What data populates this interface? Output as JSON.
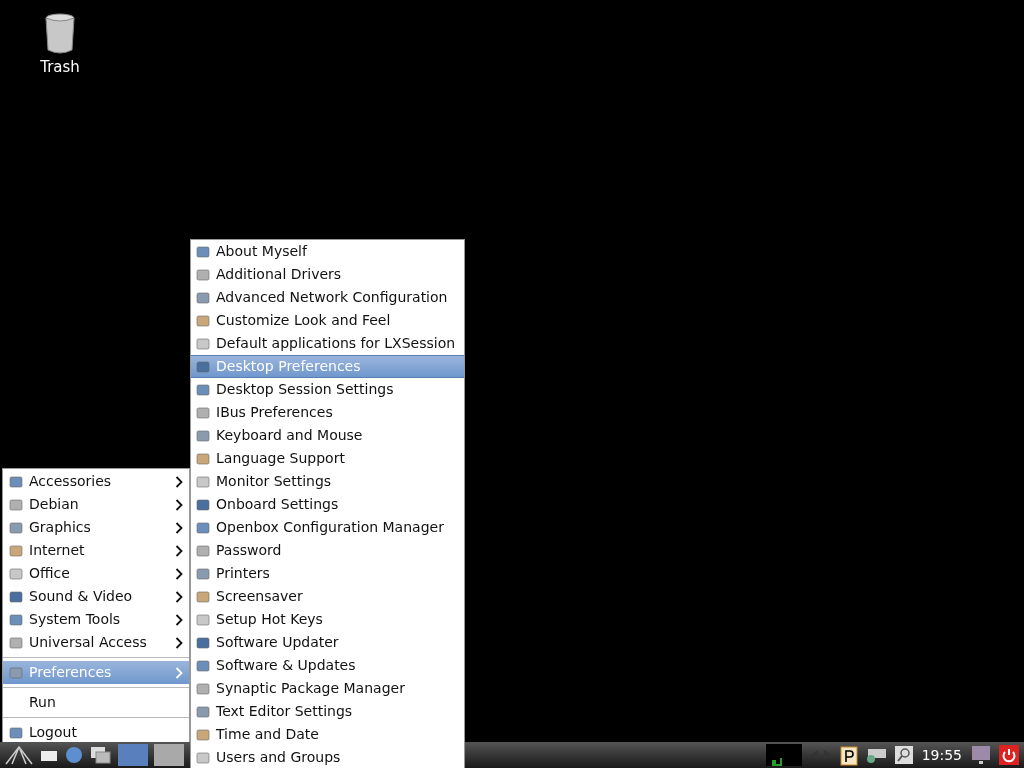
{
  "desktop": {
    "icons": [
      {
        "label": "Trash"
      }
    ]
  },
  "main_menu": {
    "sections": [
      [
        {
          "label": "Accessories",
          "selected": false,
          "has_submenu": true
        },
        {
          "label": "Debian",
          "selected": false,
          "has_submenu": true
        },
        {
          "label": "Graphics",
          "selected": false,
          "has_submenu": true
        },
        {
          "label": "Internet",
          "selected": false,
          "has_submenu": true
        },
        {
          "label": "Office",
          "selected": false,
          "has_submenu": true
        },
        {
          "label": "Sound & Video",
          "selected": false,
          "has_submenu": true
        },
        {
          "label": "System Tools",
          "selected": false,
          "has_submenu": true
        },
        {
          "label": "Universal Access",
          "selected": false,
          "has_submenu": true
        }
      ],
      [
        {
          "label": "Preferences",
          "selected": true,
          "has_submenu": true
        }
      ],
      [
        {
          "label": "Run",
          "selected": false,
          "has_submenu": false
        }
      ],
      [
        {
          "label": "Logout",
          "selected": false,
          "has_submenu": false
        }
      ]
    ]
  },
  "submenu": {
    "items": [
      {
        "label": "About Myself",
        "selected": false
      },
      {
        "label": "Additional Drivers",
        "selected": false
      },
      {
        "label": "Advanced Network Configuration",
        "selected": false
      },
      {
        "label": "Customize Look and Feel",
        "selected": false
      },
      {
        "label": "Default applications for LXSession",
        "selected": false
      },
      {
        "label": "Desktop Preferences",
        "selected": true
      },
      {
        "label": "Desktop Session Settings",
        "selected": false
      },
      {
        "label": "IBus Preferences",
        "selected": false
      },
      {
        "label": "Keyboard and Mouse",
        "selected": false
      },
      {
        "label": "Language Support",
        "selected": false
      },
      {
        "label": "Monitor Settings",
        "selected": false
      },
      {
        "label": "Onboard Settings",
        "selected": false
      },
      {
        "label": "Openbox Configuration Manager",
        "selected": false
      },
      {
        "label": "Password",
        "selected": false
      },
      {
        "label": "Printers",
        "selected": false
      },
      {
        "label": "Screensaver",
        "selected": false
      },
      {
        "label": "Setup Hot Keys",
        "selected": false
      },
      {
        "label": "Software Updater",
        "selected": false
      },
      {
        "label": "Software & Updates",
        "selected": false
      },
      {
        "label": "Synaptic Package Manager",
        "selected": false
      },
      {
        "label": "Text Editor Settings",
        "selected": false
      },
      {
        "label": "Time and Date",
        "selected": false
      },
      {
        "label": "Users and Groups",
        "selected": false
      }
    ]
  },
  "taskbar": {
    "windows": [
      {
        "selected": true
      },
      {
        "selected": false
      }
    ],
    "clock": "19:55"
  }
}
